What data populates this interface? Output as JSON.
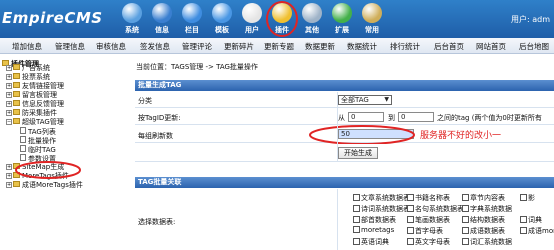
{
  "app": {
    "logo": "EmpireCMS",
    "user_label": "用户: adm"
  },
  "top_nav": [
    {
      "label": "系统",
      "icon": "globe-icon",
      "color": "#5aa0e0"
    },
    {
      "label": "信息",
      "icon": "info-icon",
      "color": "#3a7fd0"
    },
    {
      "label": "栏目",
      "icon": "column-icon",
      "color": "#3f8de0"
    },
    {
      "label": "模板",
      "icon": "template-icon",
      "color": "#4a97e4"
    },
    {
      "label": "用户",
      "icon": "user-icon",
      "color": "#e5e5e5"
    },
    {
      "label": "插件",
      "icon": "plugin-icon",
      "color": "#f0c030"
    },
    {
      "label": "其他",
      "icon": "gear-icon",
      "color": "#9fb3c8"
    },
    {
      "label": "扩展",
      "icon": "plus-icon",
      "color": "#44b04a"
    },
    {
      "label": "常用",
      "icon": "book-icon",
      "color": "#cfae5a"
    }
  ],
  "sub_nav": [
    "增加信息",
    "管理信息",
    "审核信息",
    "签发信息",
    "管理评论",
    "更新碎片",
    "更新专题",
    "数据更新",
    "数据统计",
    "排行统计",
    "后台首页",
    "网站首页",
    "后台地图"
  ],
  "sidebar": {
    "title": "插件管理",
    "items": [
      {
        "label": "广告系统"
      },
      {
        "label": "投票系统"
      },
      {
        "label": "友情链接管理"
      },
      {
        "label": "留言板管理"
      },
      {
        "label": "信息反馈管理"
      },
      {
        "label": "防采集插件"
      },
      {
        "label": "超级TAG管理"
      },
      {
        "label": "TAG列表"
      },
      {
        "label": "批量操作"
      },
      {
        "label": "临时TAG"
      },
      {
        "label": "参数设置"
      },
      {
        "label": "SiteMap生成"
      },
      {
        "label": "MoreTags插件"
      },
      {
        "label": "成语MoreTags插件"
      }
    ]
  },
  "breadcrumb": {
    "prefix": "当前位置：",
    "link1": "TAGS管理",
    "sep": " -> ",
    "link2": "TAG批量操作"
  },
  "panel1": {
    "title": "批量生成TAG",
    "rows": {
      "category_label": "分类",
      "category_value": "全部TAG",
      "id_label": "按TagID更新:",
      "from": "从",
      "from_value": "0",
      "to": "到",
      "to_value": "0",
      "range_hint": "之间的tag (两个值为0时更新所有",
      "per_group_label": "每组刷新数",
      "per_group_value": "50",
      "start_button": "开始生成"
    }
  },
  "annotation": "服务器不好的改小一",
  "panel2": {
    "title": "TAG批量关联",
    "label": "选择数据表:",
    "options": [
      [
        "文章系统数据表",
        "书籍名称表",
        "章节内容表",
        "影"
      ],
      [
        "诗词系统数据表",
        "名句系统数据表",
        "字典系统数据"
      ],
      [
        "部首数据表",
        "笔画数据表",
        "结构数据表",
        "词典"
      ],
      [
        "moretags",
        "首字母表",
        "成语数据表",
        "成语moret"
      ],
      [
        "英语词典",
        "英文字母表",
        "词汇系统数据"
      ]
    ]
  },
  "colors": {
    "header_blue": "#2a70bd",
    "panel_blue": "#3c73bb",
    "annotation_red": "#e02424"
  }
}
